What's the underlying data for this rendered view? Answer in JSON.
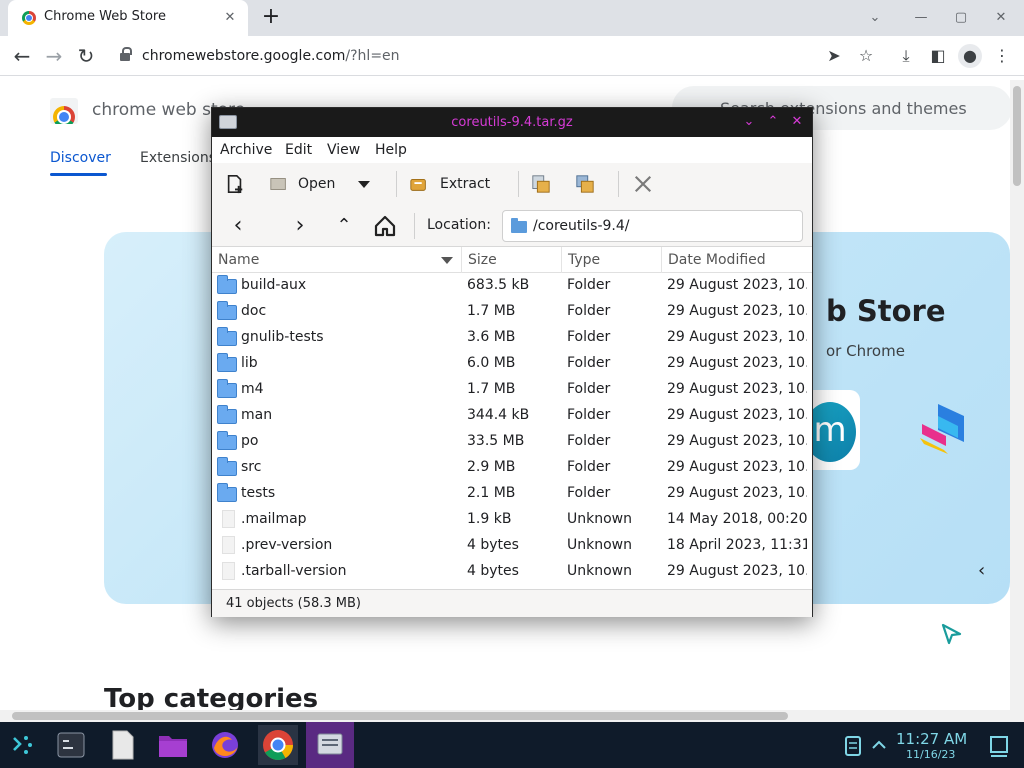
{
  "browser": {
    "tab_title": "Chrome Web Store",
    "tab_close_glyph": "✕",
    "newtab_glyph": "+",
    "url_host": "chromewebstore.google.com",
    "url_path": "/?hl=en",
    "win_min_glyph": "—",
    "win_max_glyph": "▢",
    "win_close_glyph": "✕",
    "chevron_glyph": "⌄"
  },
  "store": {
    "name": "chrome web store",
    "search_placeholder": "Search extensions and themes",
    "nav_discover": "Discover",
    "nav_extensions": "Extensions",
    "hero_title": "b Store",
    "hero_subtitle": "or Chrome",
    "hero_card_letter": "m",
    "carousel_prev": "‹",
    "top_categories": "Top categories"
  },
  "archive": {
    "title": "coreutils-9.4.tar.gz",
    "menus": [
      "Archive",
      "Edit",
      "View",
      "Help"
    ],
    "toolbar": {
      "open_label": "Open",
      "extract_label": "Extract"
    },
    "location_label": "Location:",
    "location_value": "/coreutils-9.4/",
    "columns": [
      "Name",
      "Size",
      "Type",
      "Date Modified"
    ],
    "rows": [
      {
        "name": "build-aux",
        "size": "683.5 kB",
        "type": "Folder",
        "date": "29 August 2023, 10…",
        "kind": "folder"
      },
      {
        "name": "doc",
        "size": "1.7 MB",
        "type": "Folder",
        "date": "29 August 2023, 10…",
        "kind": "folder"
      },
      {
        "name": "gnulib-tests",
        "size": "3.6 MB",
        "type": "Folder",
        "date": "29 August 2023, 10…",
        "kind": "folder"
      },
      {
        "name": "lib",
        "size": "6.0 MB",
        "type": "Folder",
        "date": "29 August 2023, 10…",
        "kind": "folder"
      },
      {
        "name": "m4",
        "size": "1.7 MB",
        "type": "Folder",
        "date": "29 August 2023, 10…",
        "kind": "folder"
      },
      {
        "name": "man",
        "size": "344.4 kB",
        "type": "Folder",
        "date": "29 August 2023, 10…",
        "kind": "folder"
      },
      {
        "name": "po",
        "size": "33.5 MB",
        "type": "Folder",
        "date": "29 August 2023, 10…",
        "kind": "folder"
      },
      {
        "name": "src",
        "size": "2.9 MB",
        "type": "Folder",
        "date": "29 August 2023, 10…",
        "kind": "folder"
      },
      {
        "name": "tests",
        "size": "2.1 MB",
        "type": "Folder",
        "date": "29 August 2023, 10…",
        "kind": "folder"
      },
      {
        "name": ".mailmap",
        "size": "1.9 kB",
        "type": "Unknown",
        "date": "14 May 2018, 00:20",
        "kind": "file"
      },
      {
        "name": ".prev-version",
        "size": "4 bytes",
        "type": "Unknown",
        "date": "18 April 2023, 11:31",
        "kind": "file"
      },
      {
        "name": ".tarball-version",
        "size": "4 bytes",
        "type": "Unknown",
        "date": "29 August 2023, 10…",
        "kind": "file"
      }
    ],
    "status": "41 objects (58.3 MB)"
  },
  "taskbar": {
    "time": "11:27 AM",
    "date": "11/16/23"
  },
  "colors": {
    "accent_blue": "#0b57d0",
    "archive_title_magenta": "#d63bd6",
    "taskbar_bg": "#0f1b2a",
    "clock_cyan": "#7fd6e6"
  }
}
